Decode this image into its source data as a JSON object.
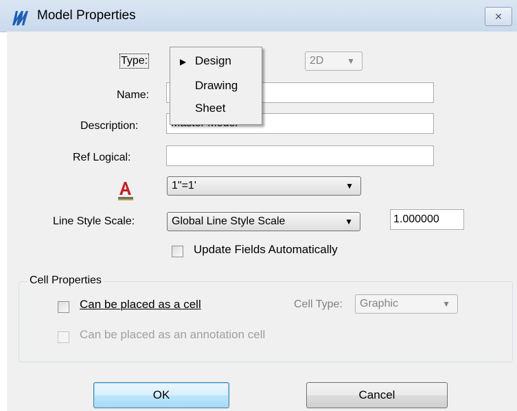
{
  "window": {
    "title": "Model Properties",
    "close_glyph": "✕"
  },
  "form": {
    "type_label": "Type:",
    "type_dim_value": "2D",
    "name_label": "Name:",
    "name_value": "",
    "description_label": "Description:",
    "description_value": "Master Model",
    "ref_logical_label": "Ref Logical:",
    "ref_logical_value": "",
    "annotation_scale_value": "1\"=1'",
    "line_style_scale_label": "Line Style Scale:",
    "line_style_scale_value": "Global Line Style Scale",
    "line_style_scale_number": "1.000000",
    "update_fields_label": "Update Fields Automatically"
  },
  "type_menu": {
    "items": [
      {
        "label": "Design",
        "checked": true
      },
      {
        "label": "Drawing",
        "checked": false
      },
      {
        "label": "Sheet",
        "checked": false
      }
    ]
  },
  "cell_properties": {
    "group_title": "Cell Properties",
    "placed_as_cell_label": "Can be placed as a cell",
    "cell_type_label": "Cell Type:",
    "cell_type_value": "Graphic",
    "annotation_cell_label": "Can be placed as an annotation cell"
  },
  "buttons": {
    "ok_label": "OK",
    "cancel_label": "Cancel"
  },
  "colors": {
    "titlebar": "#c9d9ec",
    "app_icon": "#1f5fb4",
    "annotation_icon": "#c0222a"
  }
}
